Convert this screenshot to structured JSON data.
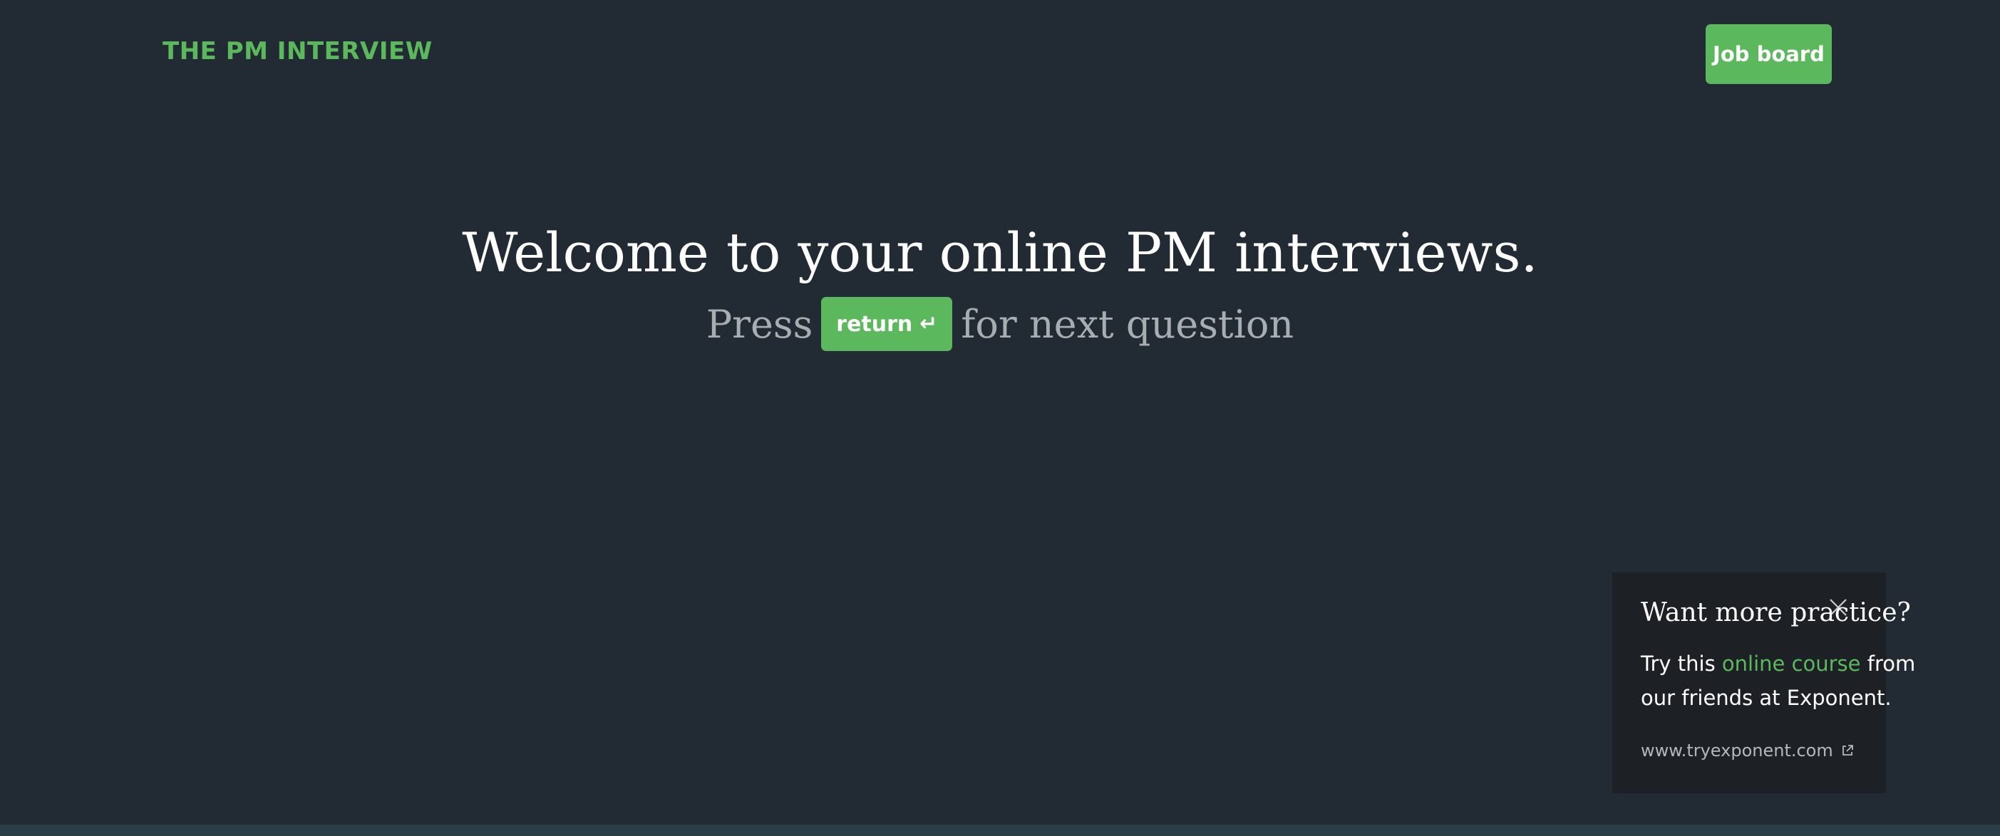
{
  "brand": "THE PM INTERVIEW",
  "header": {
    "job_board_label": "Job board"
  },
  "hero": {
    "title": "Welcome to your online PM interviews.",
    "press_text": "Press",
    "key_label": "return",
    "key_icon": "return-arrow-icon",
    "after_text": "for next question"
  },
  "popup": {
    "title": "Want more practice?",
    "body_prefix": "Try this",
    "link_text": "online course",
    "body_suffix": "from our friends at Exponent.",
    "url": "www.tryexponent.com",
    "close_icon": "close-icon",
    "external_icon": "external-link-icon"
  },
  "colors": {
    "background": "#222b33",
    "accent": "#5cb85c",
    "popup_bg": "#1d2125",
    "muted_text": "#a8adb1"
  }
}
